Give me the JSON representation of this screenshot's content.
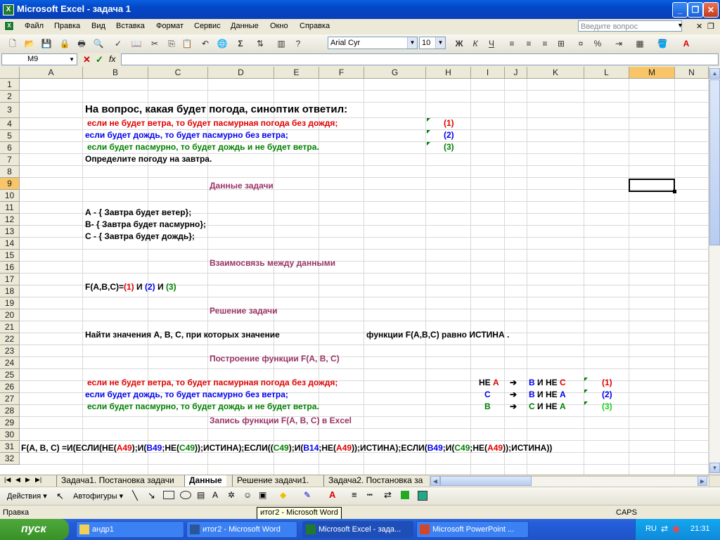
{
  "window": {
    "title": "Microsoft Excel - задача 1"
  },
  "menu": {
    "items": [
      "Файл",
      "Правка",
      "Вид",
      "Вставка",
      "Формат",
      "Сервис",
      "Данные",
      "Окно",
      "Справка"
    ],
    "help_placeholder": "Введите вопрос"
  },
  "toolbar": {
    "font": "Arial Cyr",
    "size": "10"
  },
  "formula_bar": {
    "name_box": "M9",
    "fx": "fx",
    "value": ""
  },
  "columns": [
    "A",
    "B",
    "C",
    "D",
    "E",
    "F",
    "G",
    "H",
    "I",
    "J",
    "K",
    "L",
    "M",
    "N"
  ],
  "rows": [
    "1",
    "2",
    "3",
    "4",
    "5",
    "6",
    "7",
    "8",
    "9",
    "10",
    "11",
    "12",
    "13",
    "14",
    "15",
    "16",
    "17",
    "18",
    "19",
    "20",
    "21",
    "22",
    "23",
    "24",
    "25",
    "26",
    "27",
    "28",
    "29",
    "30",
    "31",
    "32"
  ],
  "cells": {
    "r3": "На вопрос, какая будет погода, синоптик ответил:",
    "r4": "если не будет ветра, то будет пасмурная погода без дождя;",
    "r4h": "(1)",
    "r5": "если будет дождь, то будет пасмурно без ветра;",
    "r5h": "(2)",
    "r6": "если будет пасмурно, то будет дождь и не будет ветра.",
    "r6h": "(3)",
    "r7": "Определите погоду на завтра.",
    "r9": "Данные задачи",
    "r11": "А - { Завтра будет ветер};",
    "r12": "В- { Завтра будет пасмурно};",
    "r13": "С - { Завтра будет дождь};",
    "r15": "Взаимосвязь между данными",
    "r17_a": "F(A,B,C)=",
    "r17_b": "(1)",
    "r17_c": " И ",
    "r17_d": "(2)",
    "r17_e": " И ",
    "r17_f": "(3)",
    "r19": "Решение задачи",
    "r21_left": "Найти значения А, В, С, при которых значение",
    "r21_right": "функции F(A,B,C) равно  ИСТИНА .",
    "r23": "Построение функции F(A, B, C)",
    "r25": "если не будет ветра, то будет пасмурная погода без дождя;",
    "r25_i1": "НЕ ",
    "r25_i2": "А",
    "r25_k1": "В",
    "r25_k2": " И НЕ ",
    "r25_k3": "С",
    "r25_l": "(1)",
    "r26": "если будет дождь, то будет пасмурно без ветра;",
    "r26_i": "С",
    "r26_k1": "В",
    "r26_k2": " И НЕ ",
    "r26_k3": "А",
    "r26_l": "(2)",
    "r27": "если будет пасмурно, то будет дождь и не будет ветра.",
    "r27_i": "В",
    "r27_k1": "С",
    "r27_k2": " И НЕ ",
    "r27_k3": "А",
    "r27_l": "(3)",
    "arrow": "➔",
    "r28": "Запись функции  F(A, B, C)  в Excel",
    "r30": [
      {
        "t": "F(A, B, C) =И(ЕСЛИ(НЕ(",
        "c": "black"
      },
      {
        "t": "A49",
        "c": "red"
      },
      {
        "t": ");И(",
        "c": "black"
      },
      {
        "t": "B49",
        "c": "blue"
      },
      {
        "t": ";НЕ(",
        "c": "black"
      },
      {
        "t": "C49",
        "c": "green"
      },
      {
        "t": "));ИСТИНА);ЕСЛИ((",
        "c": "black"
      },
      {
        "t": "C49",
        "c": "green"
      },
      {
        "t": ");И(",
        "c": "black"
      },
      {
        "t": "B14",
        "c": "blue"
      },
      {
        "t": ";НЕ(",
        "c": "black"
      },
      {
        "t": "A49",
        "c": "red"
      },
      {
        "t": "));ИСТИНА);ЕСЛИ(",
        "c": "black"
      },
      {
        "t": "B49",
        "c": "blue"
      },
      {
        "t": ";И(",
        "c": "black"
      },
      {
        "t": "C49",
        "c": "green"
      },
      {
        "t": ";НЕ(",
        "c": "black"
      },
      {
        "t": "A49",
        "c": "red"
      },
      {
        "t": "));ИСТИНА))",
        "c": "black"
      }
    ]
  },
  "sheets": [
    "Задача1. Постановка задачи",
    "Данные",
    "Решение задачи1.",
    "Задача2. Постановка за"
  ],
  "drawbar": {
    "actions": "Действия",
    "autoshapes": "Автофигуры"
  },
  "status": {
    "left": "Правка",
    "caps": "CAPS",
    "tooltip": "итог2 - Microsoft Word"
  },
  "taskbar": {
    "start": "пуск",
    "tasks": [
      "андр1",
      "итог2 - Microsoft Word",
      "Microsoft Excel - зада...",
      "Microsoft PowerPoint ..."
    ],
    "lang": "RU",
    "clock": "21:31"
  },
  "colors": {
    "red": "#e00000",
    "blue": "#0000ee",
    "green": "#008000",
    "purple": "#993366",
    "selected_header": "#f8c668"
  }
}
